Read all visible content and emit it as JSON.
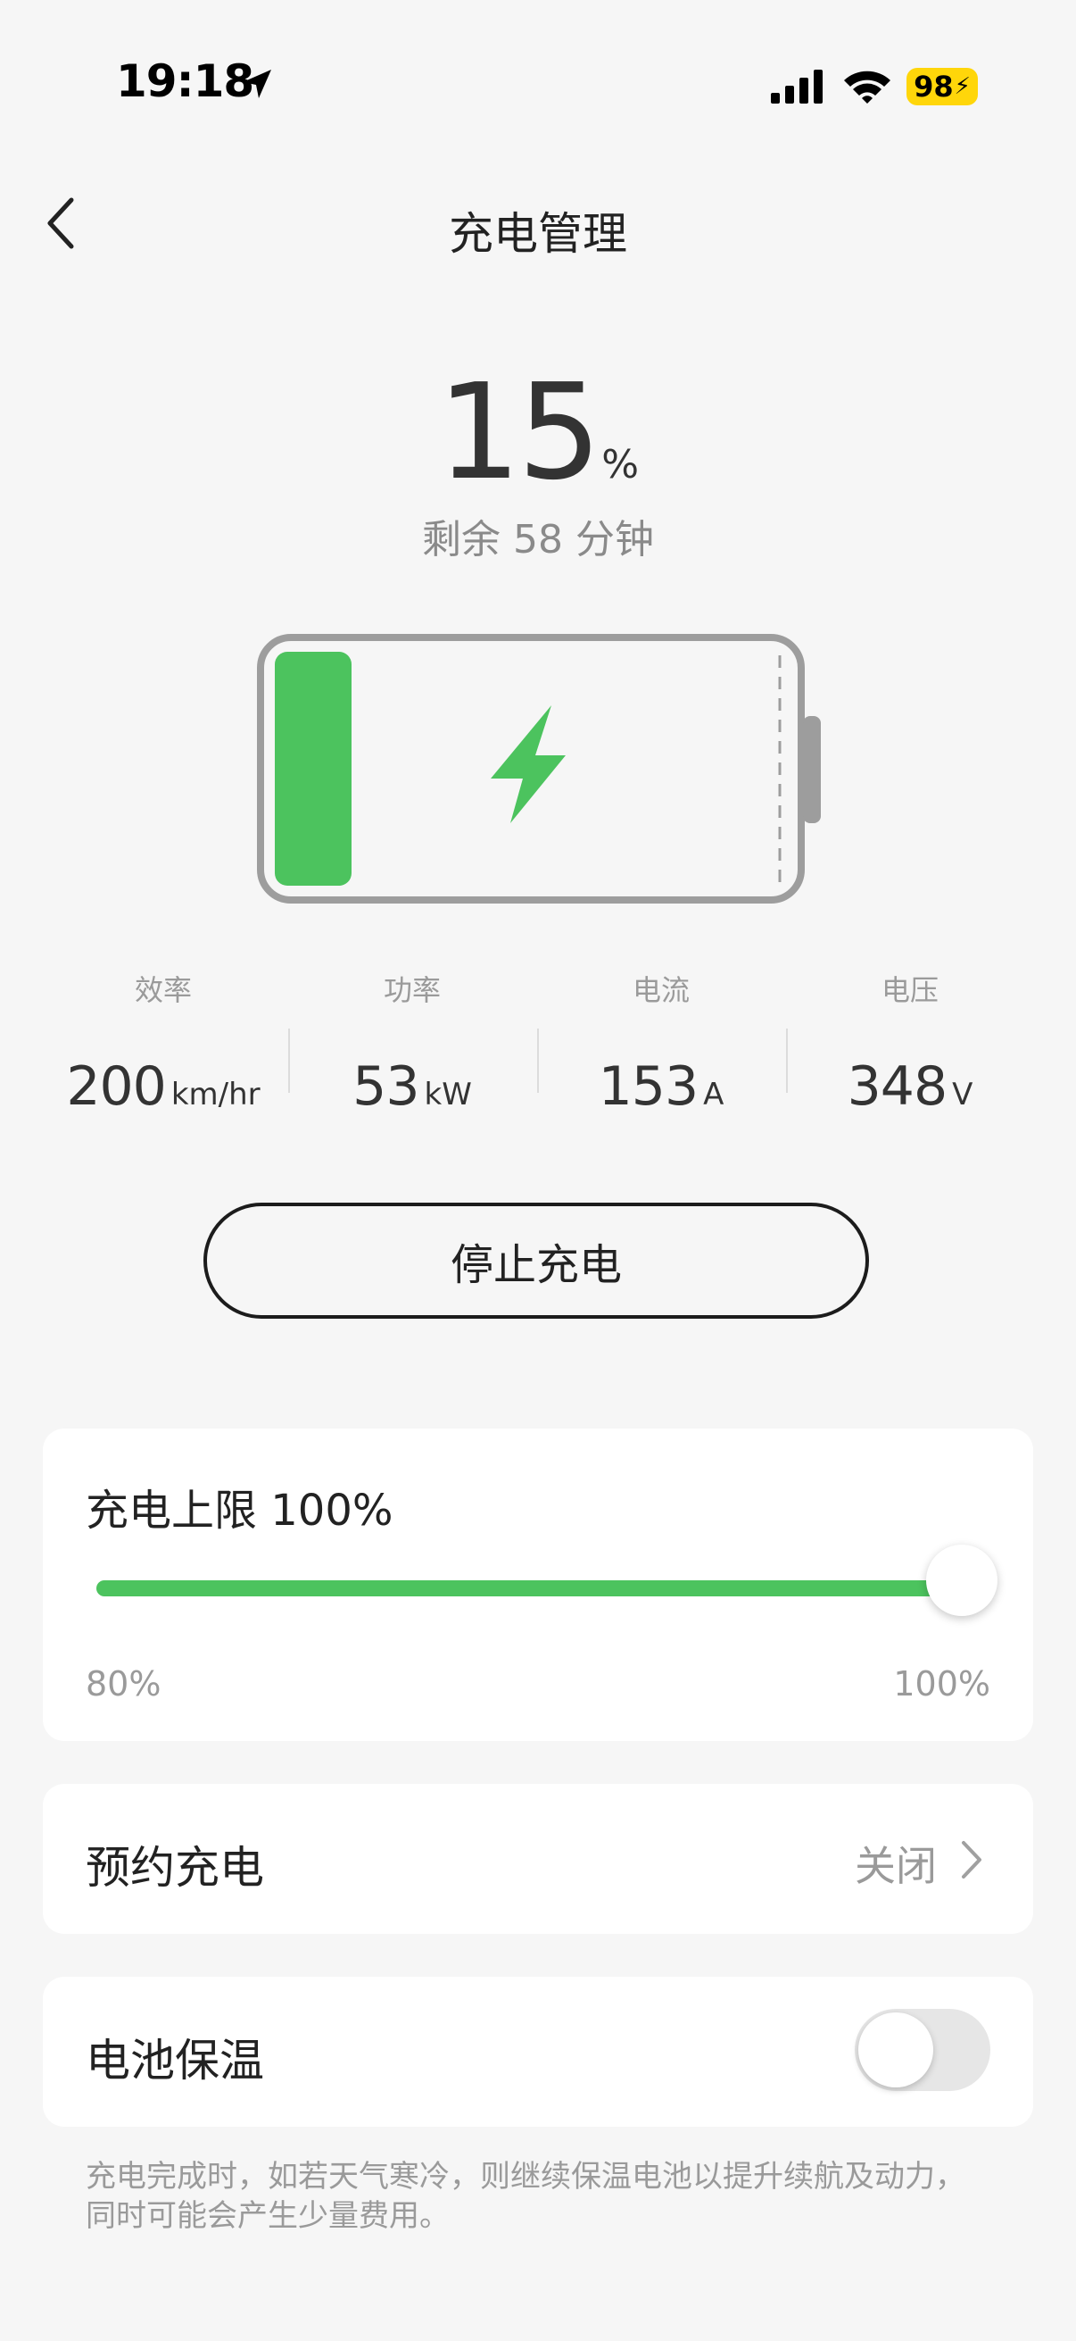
{
  "status_bar": {
    "time": "19:18",
    "battery_level": "98"
  },
  "header": {
    "title": "充电管理"
  },
  "charge": {
    "percent": "15",
    "percent_unit": "%",
    "remaining": "剩余 58 分钟",
    "level_fraction": 0.15
  },
  "stats": [
    {
      "label": "效率",
      "value": "200",
      "unit": "km/hr"
    },
    {
      "label": "功率",
      "value": "53",
      "unit": "kW"
    },
    {
      "label": "电流",
      "value": "153",
      "unit": "A"
    },
    {
      "label": "电压",
      "value": "348",
      "unit": "V"
    }
  ],
  "stop_button": {
    "label": "停止充电"
  },
  "limit": {
    "title": "充电上限 100%",
    "min_label": "80%",
    "max_label": "100%",
    "value_percent": 100
  },
  "schedule": {
    "label": "预约充电",
    "value": "关闭"
  },
  "battery_warm": {
    "label": "电池保温",
    "enabled": false
  },
  "note": "充电完成时，如若天气寒冷，则继续保温电池以提升续航及动力，同时可能会产生少量费用。",
  "colors": {
    "accent_green": "#4cc35e",
    "background": "#f6f6f6",
    "status_battery": "#ffd60a"
  }
}
